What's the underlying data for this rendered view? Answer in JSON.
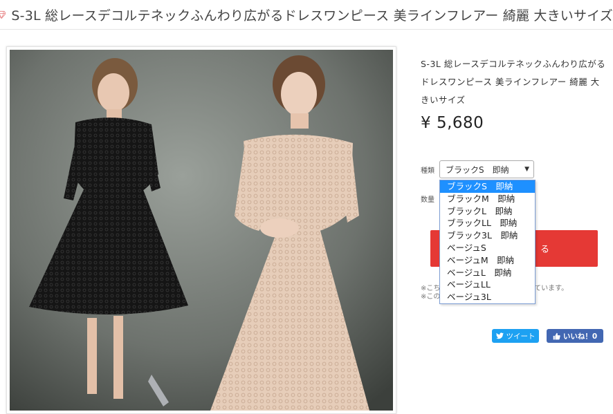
{
  "title_bar": {
    "title": "S-3L 総レースデコルテネックふんわり広がるドレスワンピース 美ラインフレアー 綺麗 大きいサイズ"
  },
  "product": {
    "title": "S-3L 総レースデコルテネックふんわり広がるドレスワンピース 美ラインフレアー 綺麗 大きいサイズ",
    "price": "¥ 5,680"
  },
  "form": {
    "type_label": "種類",
    "quantity_label": "数量",
    "selected": "ブラックS　即納",
    "options": [
      "ブラックS　即納",
      "ブラックM　即納",
      "ブラックL　即納",
      "ブラックLL　即納",
      "ブラック3L　即納",
      "ベージュS",
      "ベージュM　即納",
      "ベージュL　即納",
      "ベージュLL",
      "ベージュ3L"
    ],
    "cart_label_visible": "る"
  },
  "notes": {
    "note1": "※こち",
    "note1_tail": "れています。",
    "note2": "※この"
  },
  "social": {
    "tweet": "ツイート",
    "like": "いいね！0"
  },
  "colors": {
    "cart": "#e53935",
    "select_highlight": "#1e90ff",
    "twitter": "#1da1f2",
    "facebook": "#4267b2"
  },
  "icons": {
    "title_icon": "gem-icon",
    "tweet_icon": "twitter-bird-icon",
    "like_icon": "thumbs-up-icon"
  }
}
